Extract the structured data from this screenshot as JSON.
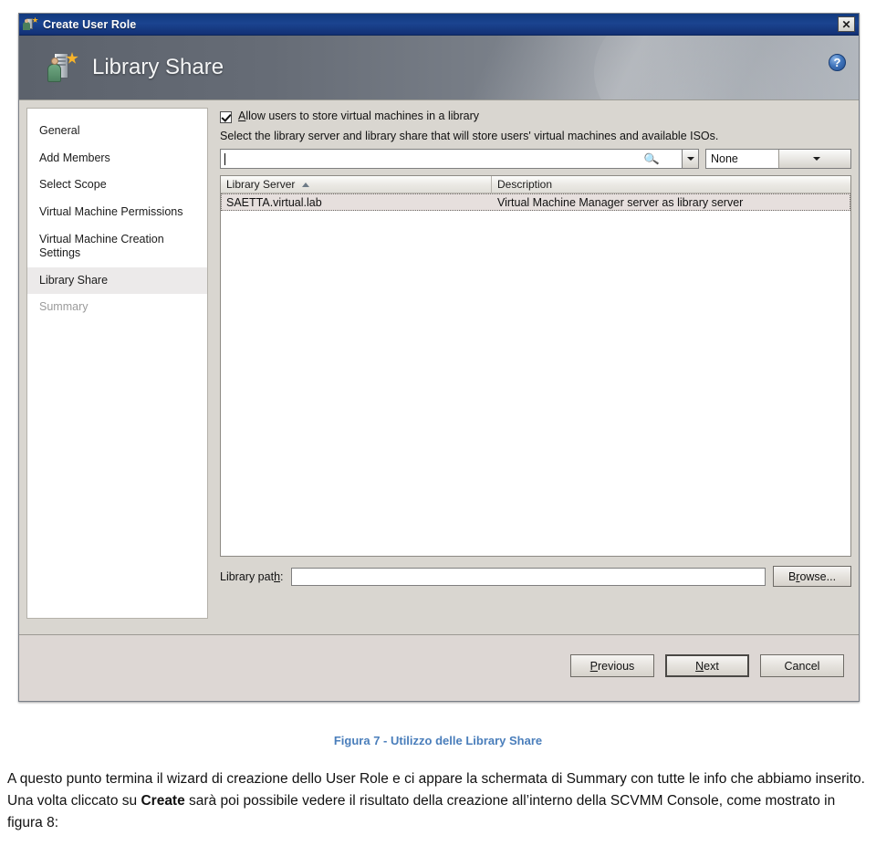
{
  "window": {
    "title": "Create User Role",
    "title_icon": "user-role-icon",
    "close_label": "✕",
    "banner_title": "Library Share",
    "banner_icon": "library-server-icon",
    "help_label": "?"
  },
  "sidebar": {
    "items": [
      {
        "label": "General",
        "state": "normal"
      },
      {
        "label": "Add Members",
        "state": "normal"
      },
      {
        "label": "Select Scope",
        "state": "normal"
      },
      {
        "label": "Virtual Machine Permissions",
        "state": "normal"
      },
      {
        "label": "Virtual Machine Creation Settings",
        "state": "normal"
      },
      {
        "label": "Library Share",
        "state": "selected"
      },
      {
        "label": "Summary",
        "state": "disabled"
      }
    ]
  },
  "main": {
    "checkbox": {
      "checked": true,
      "label_underlined": "A",
      "label_rest": "llow users to store virtual machines in a library"
    },
    "description": "Select the library server and library share that will store users' virtual machines and available ISOs.",
    "search": {
      "value": "",
      "icon": "magnifier-icon",
      "dropdown_icon": "chevron-down-icon"
    },
    "filter": {
      "selected": "None",
      "dropdown_icon": "chevron-down-icon"
    },
    "table": {
      "columns": [
        {
          "label": "Library Server",
          "sort": "asc"
        },
        {
          "label": "Description",
          "sort": ""
        }
      ],
      "rows": [
        {
          "library_server": "SAETTA.virtual.lab",
          "description": "Virtual Machine Manager server as library server",
          "selected": true
        }
      ]
    },
    "library_path": {
      "label_pre": "Library pat",
      "label_underlined": "h",
      "label_post": ":",
      "value": "",
      "browse_pre": "B",
      "browse_underlined": "r",
      "browse_post": "owse..."
    }
  },
  "footer": {
    "buttons": [
      {
        "pre": "",
        "underlined": "P",
        "post": "revious",
        "default": false
      },
      {
        "pre": "",
        "underlined": "N",
        "post": "ext",
        "default": true
      },
      {
        "pre": "Cancel",
        "underlined": "",
        "post": "",
        "default": false
      }
    ]
  },
  "document": {
    "caption": "Figura 7 - Utilizzo delle Library Share",
    "paragraph_part1": "A questo punto termina il wizard di creazione dello User Role e ci appare la schermata di Summary con tutte le info che abbiamo inserito. Una volta cliccato su ",
    "paragraph_bold": "Create",
    "paragraph_part2": " sarà poi possibile vedere il risultato della creazione all’interno della SCVMM Console, come mostrato in figura 8:"
  },
  "colors": {
    "titlebar": "#1b4490",
    "caption_blue": "#4a7ebb",
    "selected_row": "#e6dfdd",
    "dialog_face": "#d9d6d0"
  }
}
